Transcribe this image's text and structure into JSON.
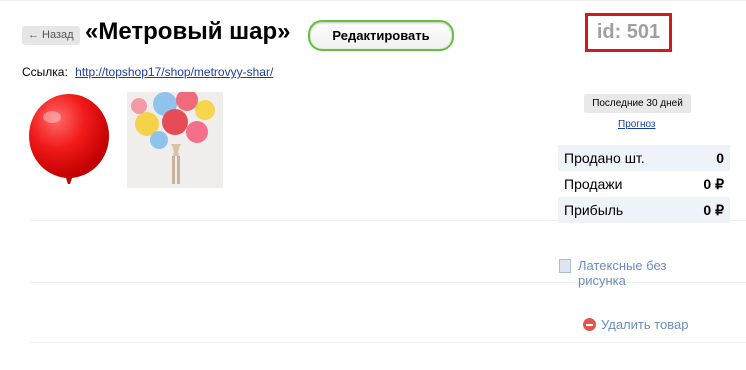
{
  "header": {
    "back_label": "Назад",
    "title": "«Метровый шар»",
    "edit_label": "Редактировать",
    "id_label": "id: 501"
  },
  "link": {
    "label": "Ссылка:",
    "url": "http://topshop17/shop/metrovyy-shar/"
  },
  "stats_panel": {
    "period_label": "Последние 30 дней",
    "forecast_label": "Прогноз",
    "rows": [
      {
        "label": "Продано шт.",
        "value": "0"
      },
      {
        "label": "Продажи",
        "value": "0 ₽"
      },
      {
        "label": "Прибыль",
        "value": "0 ₽"
      }
    ]
  },
  "category": {
    "label": "Латексные без рисунка"
  },
  "actions": {
    "delete_label": "Удалить товар"
  },
  "colors": {
    "edit_border": "#62c23e",
    "id_border": "#d31a1a",
    "link": "#1a3ea5",
    "soft_link": "#6b8cc4"
  }
}
